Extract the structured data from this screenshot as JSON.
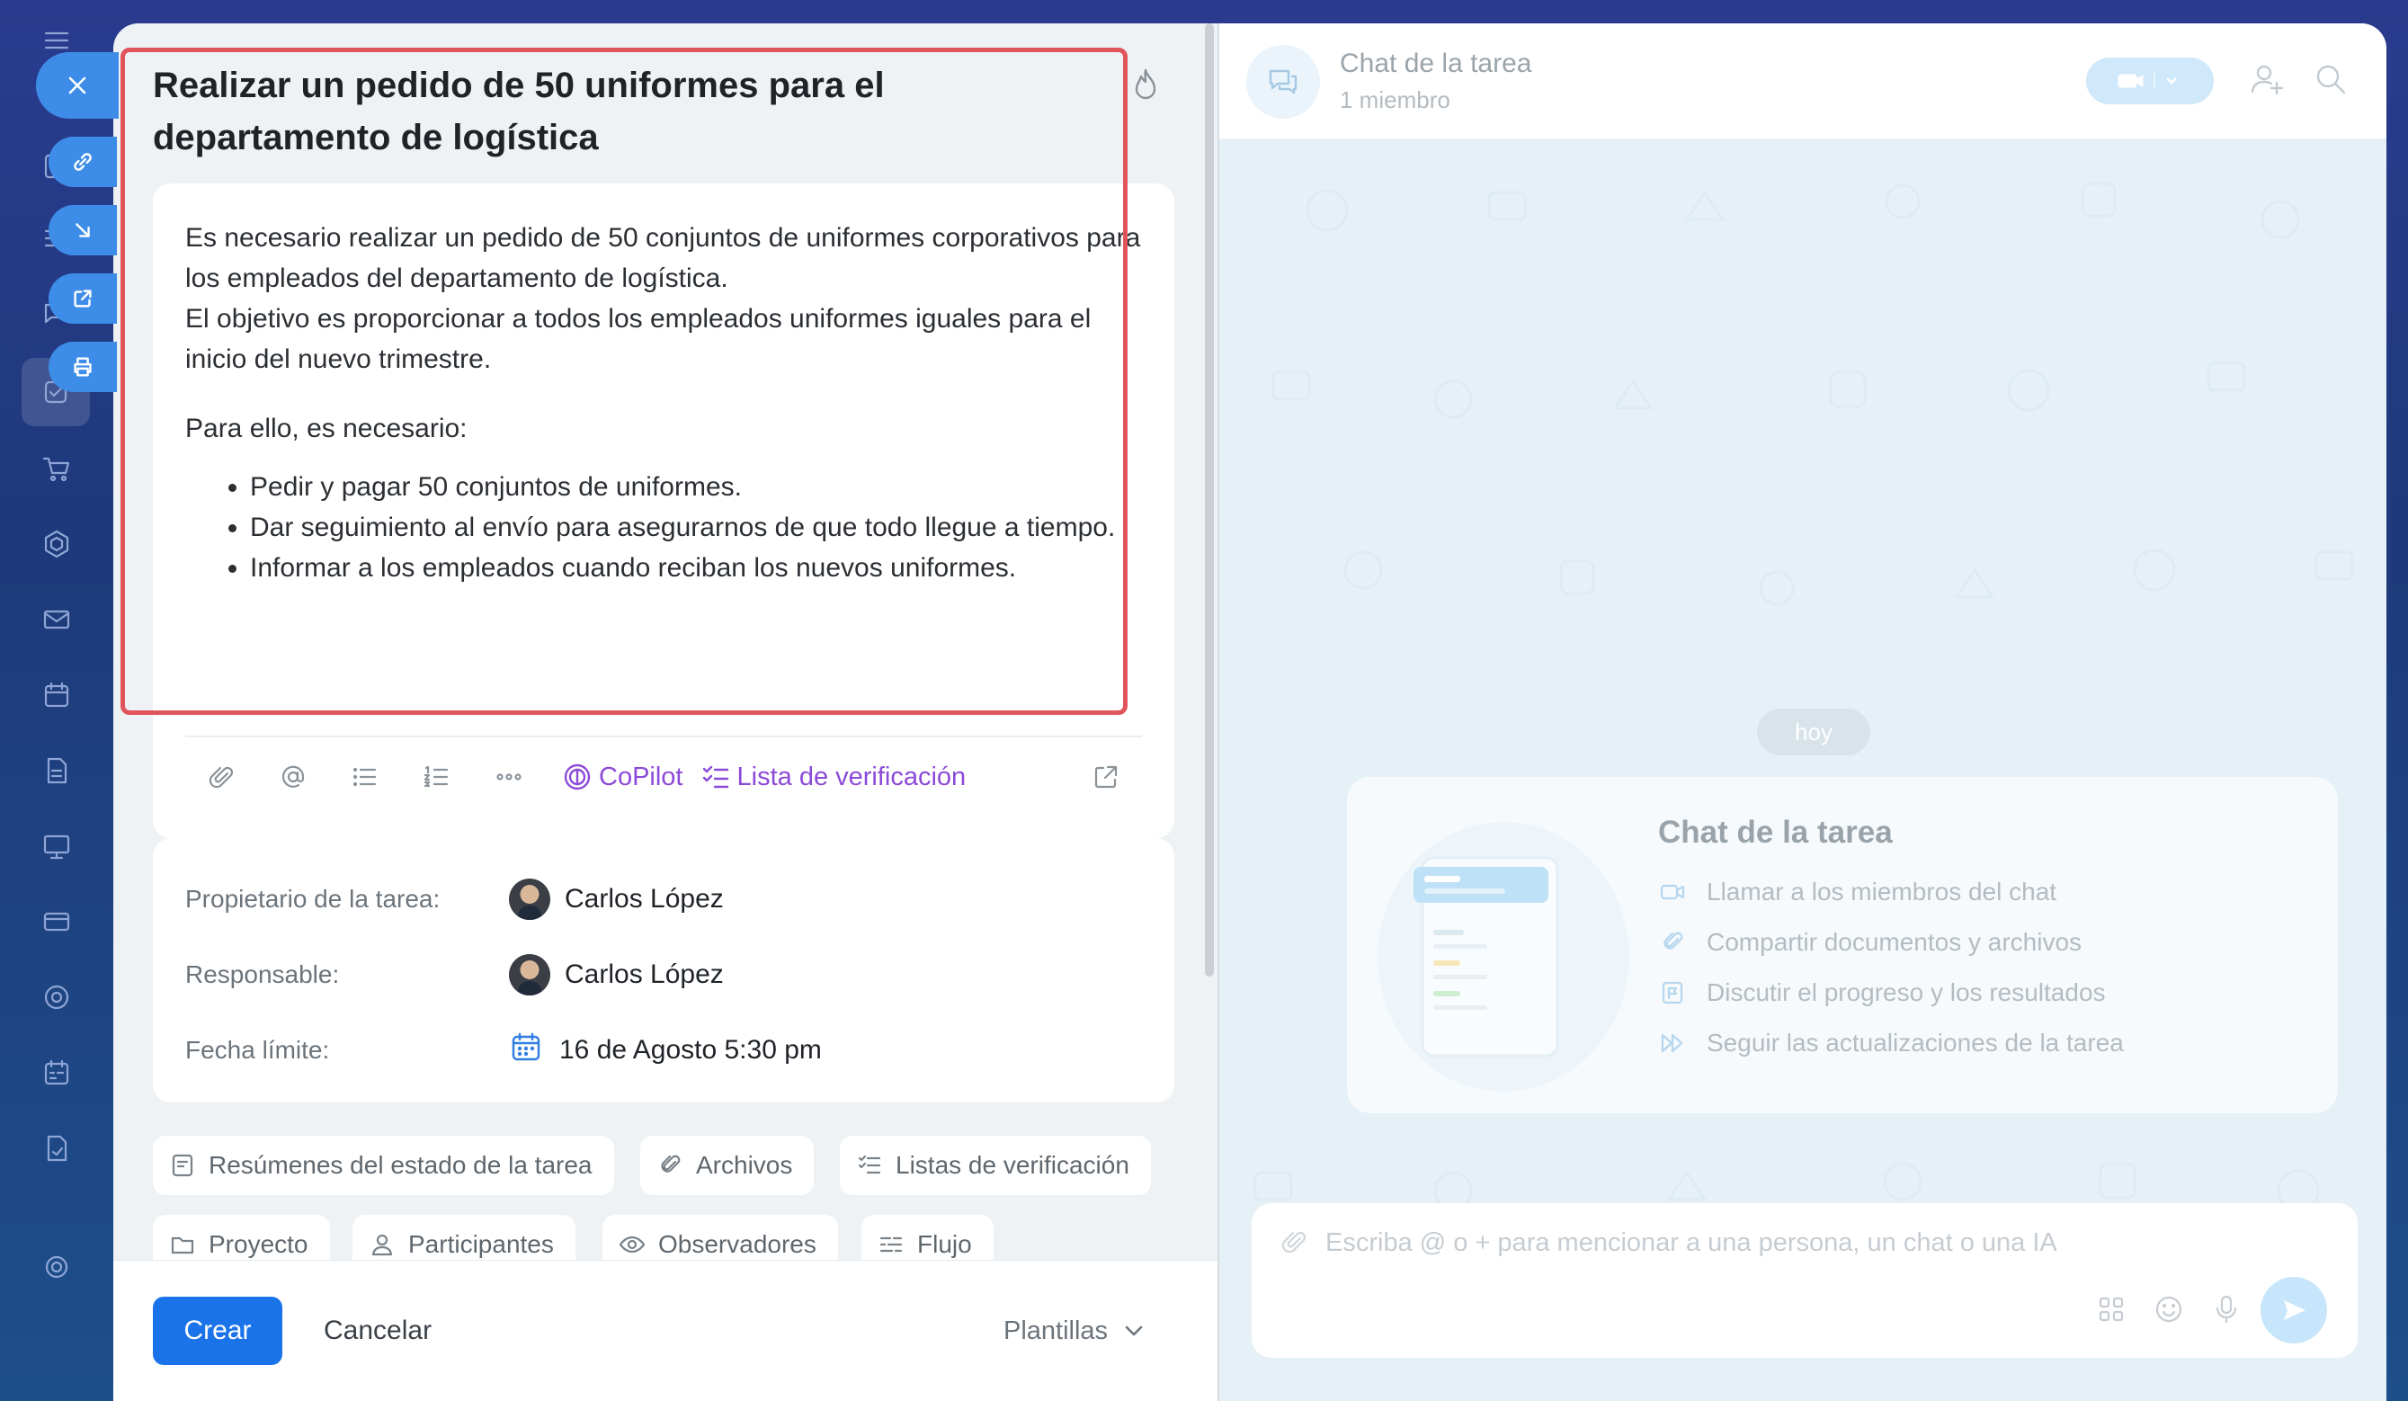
{
  "task": {
    "title": "Realizar un pedido de 50 uniformes para el departamento de logística",
    "description": {
      "paragraph1_line1": "Es necesario realizar un pedido de 50 conjuntos de uniformes corporativos para los empleados del departamento de logística.",
      "paragraph1_line2": "El objetivo es proporcionar a todos los empleados uniformes iguales para el inicio del nuevo trimestre.",
      "paragraph2": "Para ello, es necesario:",
      "bullets": [
        "Pedir y pagar 50 conjuntos de uniformes.",
        "Dar seguimiento al envío para asegurarnos de que todo llegue a tiempo.",
        "Informar a los empleados cuando reciban los nuevos uniformes."
      ]
    },
    "highlight_color": "#e0545c",
    "toolbar": {
      "icons": [
        "paperclip-icon",
        "mention-icon",
        "bulleted-list-icon",
        "numbered-list-icon",
        "more-dots-icon"
      ],
      "copilot_label": "CoPilot",
      "checklist_label": "Lista de verificación",
      "accent_color": "#8c4ad8"
    },
    "fields": {
      "owner_label": "Propietario de la tarea:",
      "owner_value": "Carlos López",
      "responsible_label": "Responsable:",
      "responsible_value": "Carlos López",
      "deadline_label": "Fecha límite:",
      "deadline_value": "16 de Agosto 5:30 pm"
    },
    "chips": [
      "Resúmenes del estado de la tarea",
      "Archivos",
      "Listas de verificación",
      "Proyecto",
      "Participantes",
      "Observadores",
      "Flujo"
    ],
    "footer": {
      "create_label": "Crear",
      "cancel_label": "Cancelar",
      "templates_label": "Plantillas",
      "primary_color": "#1a73e8"
    }
  },
  "chat": {
    "title": "Chat de la tarea",
    "members": "1 miembro",
    "day_badge": "hoy",
    "intro": {
      "title": "Chat de la tarea",
      "items": [
        "Llamar a los miembros del chat",
        "Compartir documentos y archivos",
        "Discutir el progreso y los resultados",
        "Seguir las actualizaciones de la tarea"
      ]
    },
    "composer_placeholder": "Escriba @ o + para mencionar a una persona, un chat o una IA"
  }
}
